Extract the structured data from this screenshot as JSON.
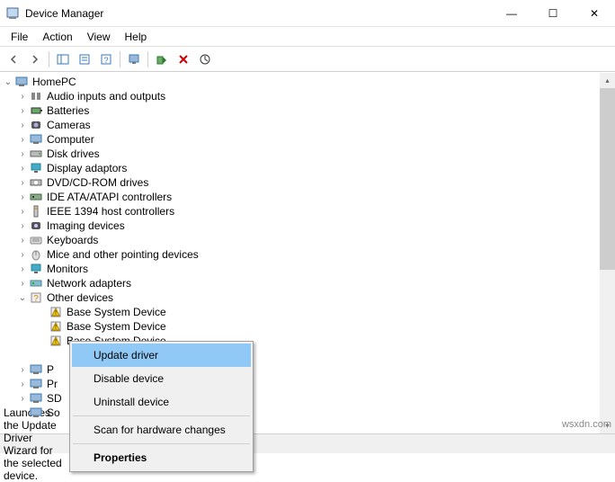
{
  "window": {
    "title": "Device Manager",
    "minimize_glyph": "—",
    "maximize_glyph": "☐",
    "close_glyph": "✕"
  },
  "menu": {
    "file": "File",
    "action": "Action",
    "view": "View",
    "help": "Help"
  },
  "tree": {
    "root": "HomePC",
    "categories": [
      "Audio inputs and outputs",
      "Batteries",
      "Cameras",
      "Computer",
      "Disk drives",
      "Display adaptors",
      "DVD/CD-ROM drives",
      "IDE ATA/ATAPI controllers",
      "IEEE 1394 host controllers",
      "Imaging devices",
      "Keyboards",
      "Mice and other pointing devices",
      "Monitors",
      "Network adapters",
      "Other devices"
    ],
    "other_devices": [
      "Base System Device",
      "Base System Device",
      "Base System Device"
    ],
    "partial": [
      "P",
      "Pr",
      "SD",
      "So"
    ]
  },
  "context_menu": {
    "update": "Update driver",
    "disable": "Disable device",
    "uninstall": "Uninstall device",
    "scan": "Scan for hardware changes",
    "properties": "Properties"
  },
  "statusbar": {
    "text": "Launches the Update Driver Wizard for the selected device."
  },
  "watermark": "wsxdn.com"
}
